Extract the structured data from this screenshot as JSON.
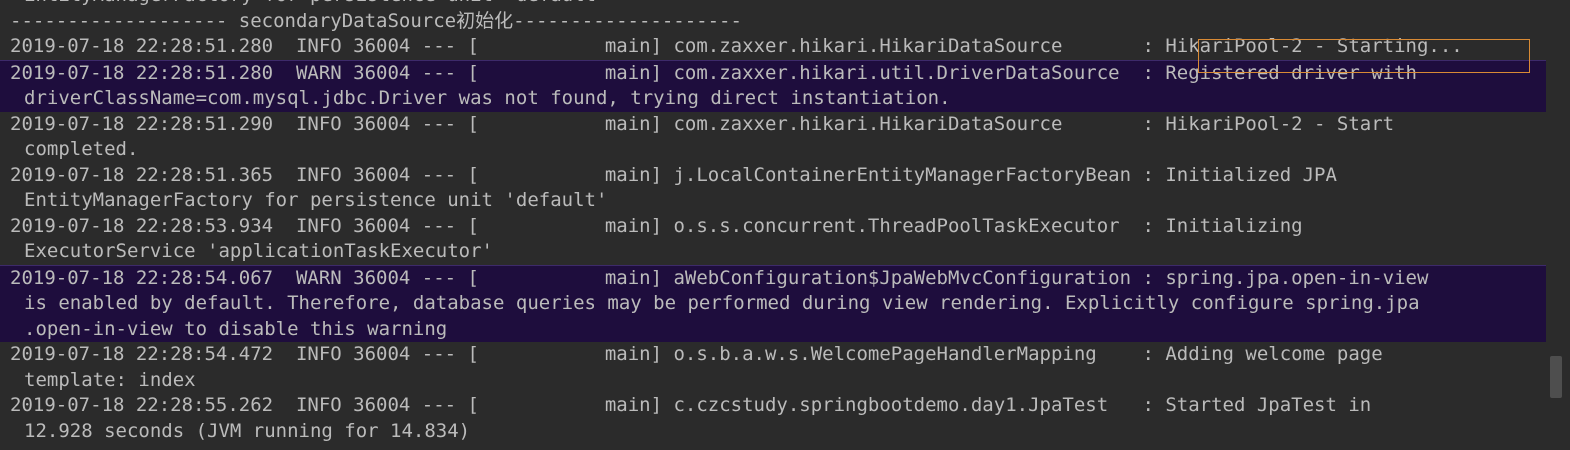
{
  "console": {
    "lines": [
      "EntityManagerFactory for persistence unit 'default'",
      "------------------- secondaryDataSource初始化--------------------",
      "2019-07-18 22:28:51.280  INFO 36004 --- [           main] com.zaxxer.hikari.HikariDataSource       : HikariPool-2 - Starting...",
      "2019-07-18 22:28:51.280  WARN 36004 --- [           main] com.zaxxer.hikari.util.DriverDataSource  : Registered driver with",
      "driverClassName=com.mysql.jdbc.Driver was not found, trying direct instantiation.",
      "2019-07-18 22:28:51.290  INFO 36004 --- [           main] com.zaxxer.hikari.HikariDataSource       : HikariPool-2 - Start",
      "completed.",
      "2019-07-18 22:28:51.365  INFO 36004 --- [           main] j.LocalContainerEntityManagerFactoryBean : Initialized JPA",
      "EntityManagerFactory for persistence unit 'default'",
      "2019-07-18 22:28:53.934  INFO 36004 --- [           main] o.s.s.concurrent.ThreadPoolTaskExecutor  : Initializing",
      "ExecutorService 'applicationTaskExecutor'",
      "2019-07-18 22:28:54.067  WARN 36004 --- [           main] aWebConfiguration$JpaWebMvcConfiguration : spring.jpa.open-in-view",
      "is enabled by default. Therefore, database queries may be performed during view rendering. Explicitly configure spring.jpa",
      ".open-in-view to disable this warning",
      "2019-07-18 22:28:54.472  INFO 36004 --- [           main] o.s.b.a.w.s.WelcomePageHandlerMapping    : Adding welcome page",
      "template: index",
      "2019-07-18 22:28:55.262  INFO 36004 --- [           main] c.czcstudy.springbootdemo.day1.JpaTest   : Started JpaTest in",
      "12.928 seconds (JVM running for 14.834)"
    ]
  },
  "colors": {
    "background": "#2b2b2b",
    "text": "#bbbbbb",
    "warn_background": "#1e0d3d",
    "highlight_border": "#d98a35"
  }
}
